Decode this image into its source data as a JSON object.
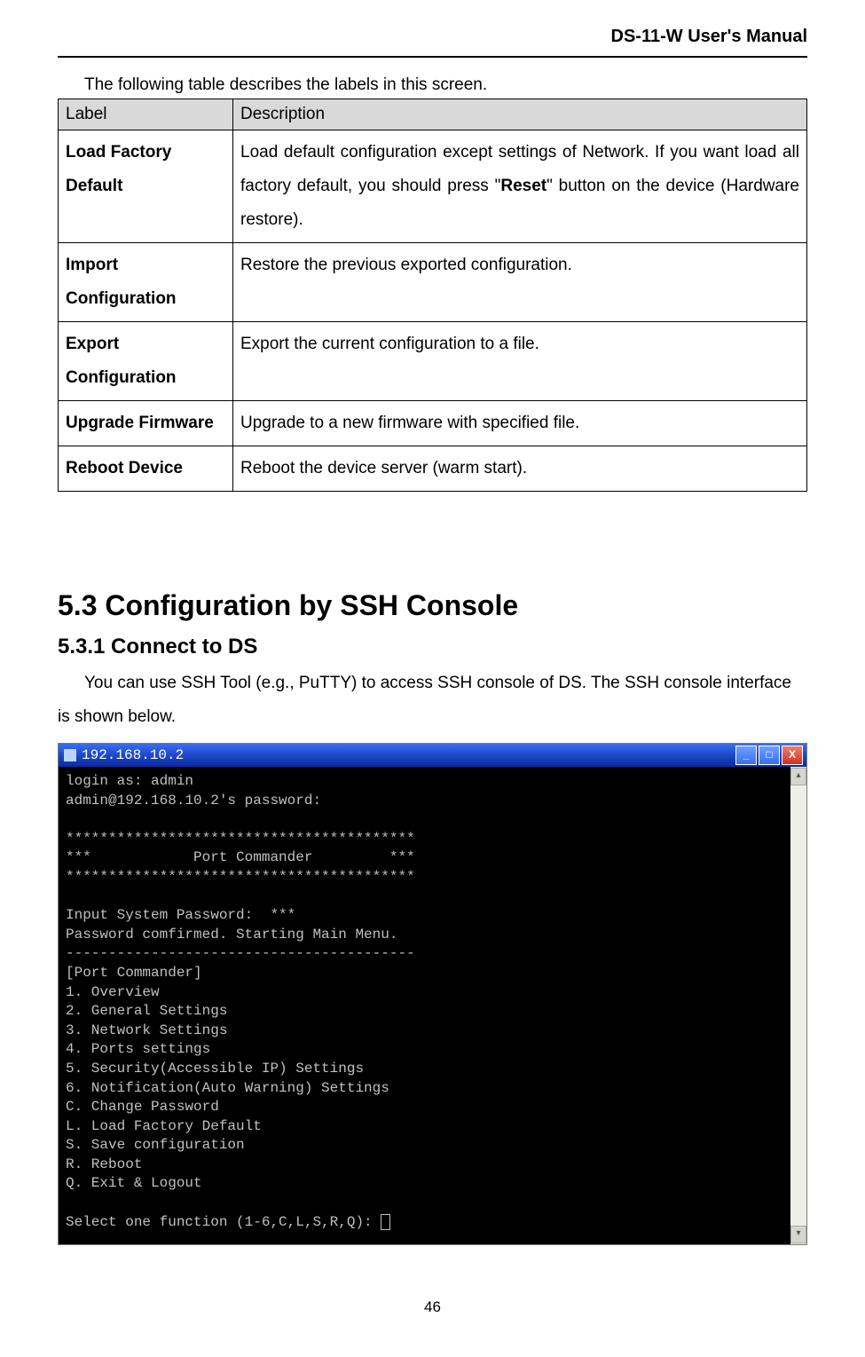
{
  "header": {
    "title": "DS-11-W User's Manual"
  },
  "intro": "The following table describes the labels in this screen.",
  "table": {
    "head": {
      "label": "Label",
      "desc": "Description"
    },
    "rows": [
      {
        "label": "Load Factory Default",
        "desc_pre": "Load default configuration except settings of Network.  If you want load all factory default, you should press \"",
        "desc_bold": "Reset",
        "desc_post": "\" button on the device (Hardware restore)."
      },
      {
        "label": "Import Configuration",
        "desc": "Restore the previous exported configuration."
      },
      {
        "label": "Export Configuration",
        "desc": "Export the current configuration to a file."
      },
      {
        "label": "Upgrade Firmware",
        "desc": "Upgrade to a new firmware with specified file."
      },
      {
        "label": "Reboot Device",
        "desc": "Reboot the device server (warm start)."
      }
    ]
  },
  "section": {
    "heading": "5.3  Configuration by SSH Console",
    "sub": "5.3.1    Connect to DS",
    "body": "You can use SSH Tool (e.g., PuTTY) to access SSH console of DS.   The SSH console interface is shown below."
  },
  "terminal": {
    "title": "192.168.10.2",
    "buttons": {
      "min": "_",
      "max": "□",
      "close": "X"
    },
    "lines": "login as: admin\nadmin@192.168.10.2's password:\n\n*****************************************\n***            Port Commander         ***\n*****************************************\n\nInput System Password:  ***\nPassword comfirmed. Starting Main Menu.\n-----------------------------------------\n[Port Commander]\n1. Overview\n2. General Settings\n3. Network Settings\n4. Ports settings\n5. Security(Accessible IP) Settings\n6. Notification(Auto Warning) Settings\nC. Change Password\nL. Load Factory Default\nS. Save configuration\nR. Reboot\nQ. Exit & Logout\n\nSelect one function (1-6,C,L,S,R,Q): "
  },
  "page_number": "46"
}
